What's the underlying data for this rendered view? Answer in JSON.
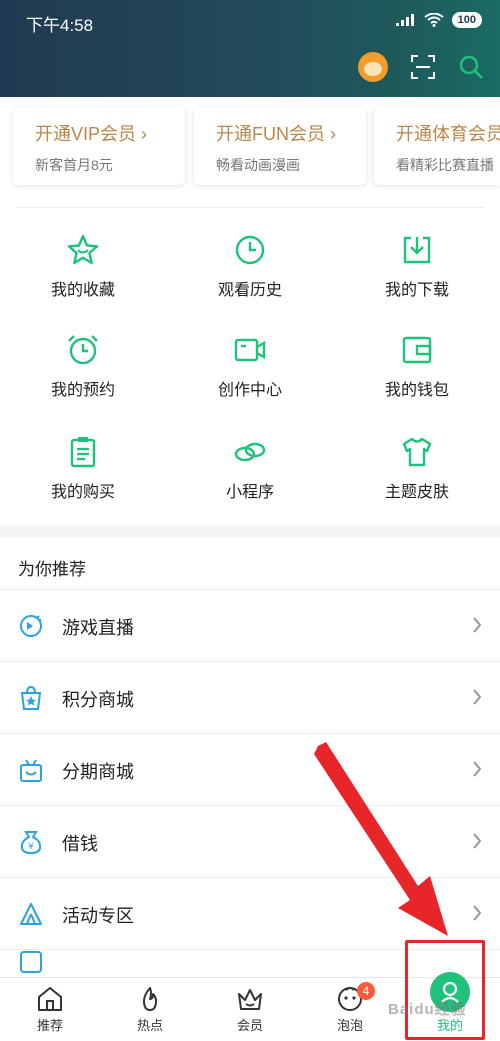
{
  "status_bar": {
    "time": "下午4:58",
    "battery": "100"
  },
  "header": {
    "icons": [
      "avatar-icon",
      "scan-icon",
      "search-icon"
    ]
  },
  "vip_cards": [
    {
      "title": "开通VIP会员",
      "subtitle": "新客首月8元"
    },
    {
      "title": "开通FUN会员",
      "subtitle": "畅看动画漫画"
    },
    {
      "title": "开通体育会员",
      "subtitle": "看精彩比赛直播"
    }
  ],
  "grid_items": [
    {
      "label": "我的收藏",
      "icon": "star-icon"
    },
    {
      "label": "观看历史",
      "icon": "clock-icon"
    },
    {
      "label": "我的下载",
      "icon": "download-icon"
    },
    {
      "label": "我的预约",
      "icon": "alarm-icon"
    },
    {
      "label": "创作中心",
      "icon": "camera-icon"
    },
    {
      "label": "我的钱包",
      "icon": "wallet-icon"
    },
    {
      "label": "我的购买",
      "icon": "clipboard-icon"
    },
    {
      "label": "小程序",
      "icon": "link-icon"
    },
    {
      "label": "主题皮肤",
      "icon": "shirt-icon"
    }
  ],
  "recommend": {
    "title": "为你推荐",
    "items": [
      {
        "label": "游戏直播",
        "icon": "game-icon"
      },
      {
        "label": "积分商城",
        "icon": "shop-star-icon"
      },
      {
        "label": "分期商城",
        "icon": "shopping-bag-icon"
      },
      {
        "label": "借钱",
        "icon": "money-bag-icon"
      },
      {
        "label": "活动专区",
        "icon": "tent-icon"
      }
    ]
  },
  "tabbar": {
    "tabs": [
      {
        "label": "推荐",
        "icon": "home-icon"
      },
      {
        "label": "热点",
        "icon": "flame-icon"
      },
      {
        "label": "会员",
        "icon": "crown-icon"
      },
      {
        "label": "泡泡",
        "icon": "bubble-face-icon",
        "badge": "4"
      },
      {
        "label": "我的",
        "icon": "me-icon",
        "active": true
      }
    ]
  },
  "colors": {
    "accent": "#1ec27a",
    "vip_gold": "#b98648",
    "badge": "#ff5a3c",
    "annotation": "#e8262a"
  },
  "watermark": "Baidu经验"
}
